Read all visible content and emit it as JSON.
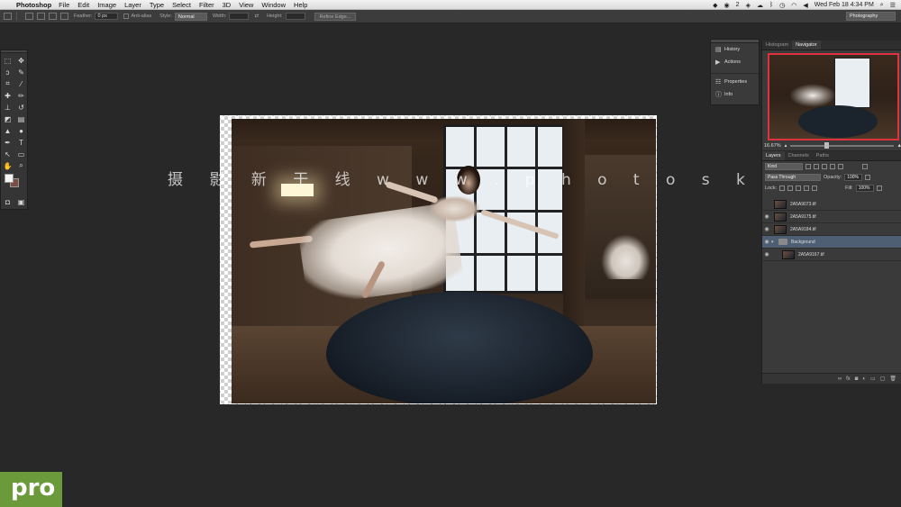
{
  "menubar": {
    "app_name": "Photoshop",
    "menus": [
      "File",
      "Edit",
      "Image",
      "Layer",
      "Type",
      "Select",
      "Filter",
      "3D",
      "View",
      "Window",
      "Help"
    ],
    "badge_count": "2",
    "clock": "Wed Feb 18  4:34 PM"
  },
  "options": {
    "feather_label": "Feather:",
    "feather_value": "0 px",
    "antialias_label": "Anti-alias",
    "style_label": "Style:",
    "style_value": "Normal",
    "width_label": "Width:",
    "height_label": "Height:",
    "refine_label": "Refine Edge...",
    "workspace": "Photography"
  },
  "dock": {
    "items": [
      "History",
      "Actions",
      "Properties",
      "Info"
    ]
  },
  "navigator": {
    "tabs": [
      "Histogram",
      "Navigator"
    ],
    "zoom": "16.67%"
  },
  "layers": {
    "tabs": [
      "Layers",
      "Channels",
      "Paths"
    ],
    "filter": "Kind",
    "blend_mode": "Pass Through",
    "opacity_label": "Opacity:",
    "opacity_value": "100%",
    "lock_label": "Lock:",
    "fill_label": "Fill:",
    "fill_value": "100%",
    "rows": [
      {
        "name": "2A5A9073.tif"
      },
      {
        "name": "2A5A9175.tif"
      },
      {
        "name": "2A5A9184.tif"
      },
      {
        "name": "Background"
      },
      {
        "name": "2A5A9167.tif"
      }
    ]
  },
  "watermark": "摄 影 新 干 线  w w w . p h o t o s k s . v i p",
  "logo": "pro"
}
